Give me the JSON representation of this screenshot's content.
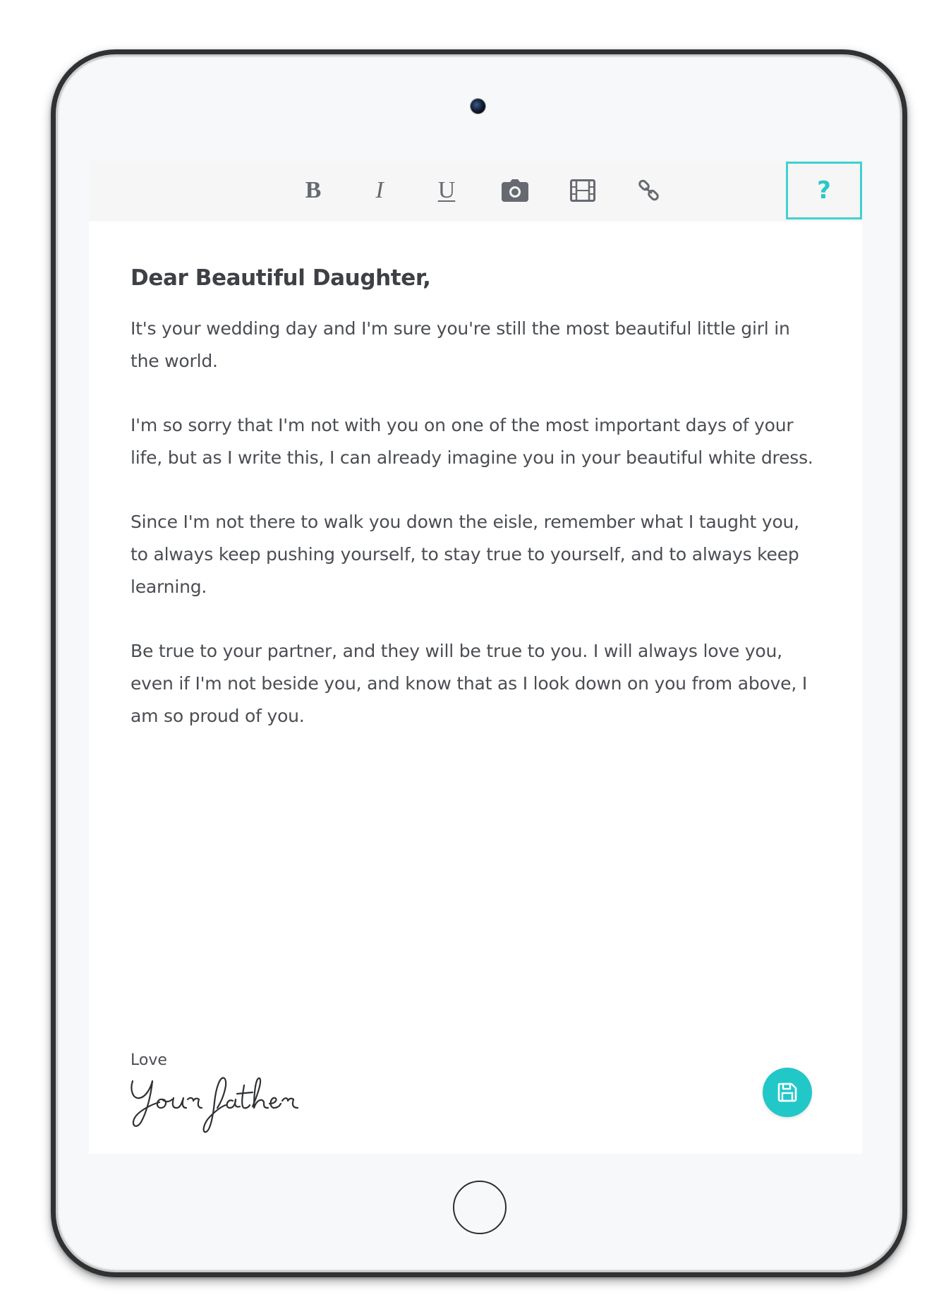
{
  "toolbar": {
    "bold_label": "B",
    "italic_label": "I",
    "underline_label": "U",
    "help_label": "?"
  },
  "letter": {
    "title": "Dear Beautiful Daughter,",
    "paragraphs": [
      "It's your wedding day and I'm sure you're still the most beautiful little girl in the world.",
      "I'm so sorry that I'm not with you on one of the most important days of your life, but as I write this, I can already imagine you in your beautiful white dress.",
      "Since I'm not there to walk you down the eisle, remember what I taught you, to always keep pushing yourself, to stay true to yourself, and to always keep learning.",
      "Be true to your partner, and they will be true to you.  I will always love you, even if I'm not beside you, and know that as I look down on you from above, I am so proud of you."
    ],
    "closing": "Love",
    "signature": "Your father"
  },
  "colors": {
    "accent": "#22c7c8",
    "text": "#4a4d52",
    "toolbar_bg": "#f6f6f6"
  },
  "icons": {
    "photo": "camera-icon",
    "video": "film-icon",
    "link": "link-icon",
    "save": "save-icon"
  }
}
